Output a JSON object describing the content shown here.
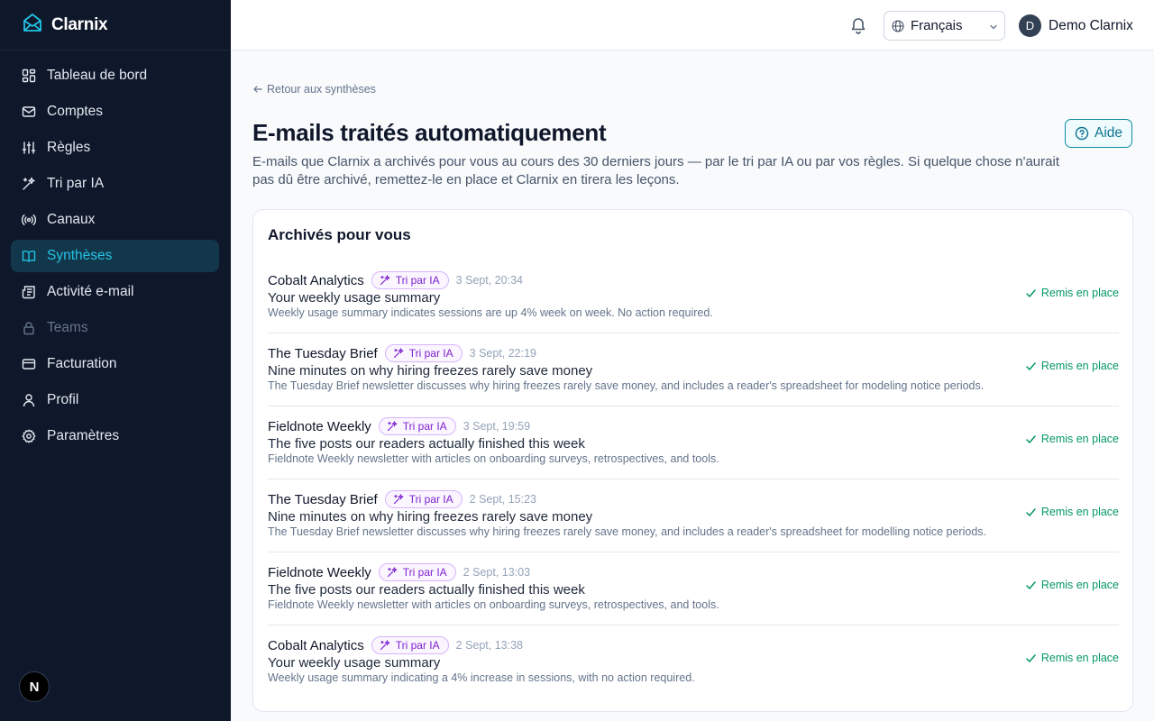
{
  "app": {
    "name": "Clarnix"
  },
  "sidebar": {
    "items": [
      {
        "label": "Tableau de bord",
        "icon": "dashboard-icon"
      },
      {
        "label": "Comptes",
        "icon": "mail-icon"
      },
      {
        "label": "Règles",
        "icon": "sliders-icon"
      },
      {
        "label": "Tri par IA",
        "icon": "sparkles-icon"
      },
      {
        "label": "Canaux",
        "icon": "radio-icon"
      },
      {
        "label": "Synthèses",
        "icon": "book-icon",
        "active": true
      },
      {
        "label": "Activité e-mail",
        "icon": "newspaper-icon"
      },
      {
        "label": "Teams",
        "icon": "lock-icon",
        "disabled": true
      },
      {
        "label": "Facturation",
        "icon": "credit-card-icon"
      },
      {
        "label": "Profil",
        "icon": "user-icon"
      },
      {
        "label": "Paramètres",
        "icon": "gear-icon"
      }
    ],
    "badge": "N"
  },
  "header": {
    "language": "Français",
    "user": {
      "initial": "D",
      "name": "Demo Clarnix"
    }
  },
  "main": {
    "back_link": "Retour aux synthèses",
    "title": "E-mails traités automatiquement",
    "description": "E-mails que Clarnix a archivés pour vous au cours des 30 derniers jours — par le tri par IA ou par vos règles. Si quelque chose n'aurait pas dû être archivé, remettez-le en place et Clarnix en tirera les leçons.",
    "help_label": "Aide",
    "card_title": "Archivés pour vous",
    "restore_label": "Remis en place",
    "emails": [
      {
        "sender": "Cobalt Analytics",
        "tag": "Tri par IA",
        "time": "3 Sept, 20:34",
        "subject": "Your weekly usage summary",
        "summary": "Weekly usage summary indicates sessions are up 4% week on week. No action required."
      },
      {
        "sender": "The Tuesday Brief",
        "tag": "Tri par IA",
        "time": "3 Sept, 22:19",
        "subject": "Nine minutes on why hiring freezes rarely save money",
        "summary": "The Tuesday Brief newsletter discusses why hiring freezes rarely save money, and includes a reader's spreadsheet for modeling notice periods."
      },
      {
        "sender": "Fieldnote Weekly",
        "tag": "Tri par IA",
        "time": "3 Sept, 19:59",
        "subject": "The five posts our readers actually finished this week",
        "summary": "Fieldnote Weekly newsletter with articles on onboarding surveys, retrospectives, and tools."
      },
      {
        "sender": "The Tuesday Brief",
        "tag": "Tri par IA",
        "time": "2 Sept, 15:23",
        "subject": "Nine minutes on why hiring freezes rarely save money",
        "summary": "The Tuesday Brief newsletter discusses why hiring freezes rarely save money, and includes a reader's spreadsheet for modelling notice periods."
      },
      {
        "sender": "Fieldnote Weekly",
        "tag": "Tri par IA",
        "time": "2 Sept, 13:03",
        "subject": "The five posts our readers actually finished this week",
        "summary": "Fieldnote Weekly newsletter with articles on onboarding surveys, retrospectives, and tools."
      },
      {
        "sender": "Cobalt Analytics",
        "tag": "Tri par IA",
        "time": "2 Sept, 13:38",
        "subject": "Your weekly usage summary",
        "summary": "Weekly usage summary indicating a 4% increase in sessions, with no action required."
      }
    ]
  },
  "colors": {
    "sidebar_bg": "#0f172a",
    "accent": "#22c3e6",
    "ai_tag": "#7e22ce",
    "success": "#059669"
  }
}
